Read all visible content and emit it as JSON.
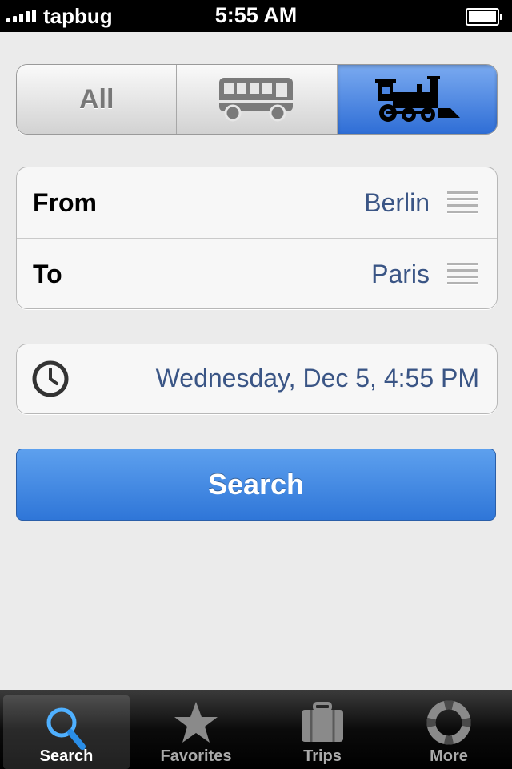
{
  "status_bar": {
    "carrier": "tapbug",
    "time": "5:55 AM"
  },
  "transport_filter": {
    "all_label": "All",
    "options": [
      "all",
      "bus-icon",
      "train-icon"
    ],
    "selected": "train",
    "accent_color": "#2f6ed6"
  },
  "route": {
    "from_label": "From",
    "from_value": "Berlin",
    "to_label": "To",
    "to_value": "Paris"
  },
  "datetime": {
    "value": "Wednesday, Dec 5, 4:55 PM",
    "icon": "clock-icon"
  },
  "search_button": {
    "label": "Search",
    "color": "#3b82dd"
  },
  "tab_bar": {
    "tabs": [
      {
        "label": "Search",
        "icon": "search-icon",
        "active": true
      },
      {
        "label": "Favorites",
        "icon": "star-icon",
        "active": false
      },
      {
        "label": "Trips",
        "icon": "briefcase-icon",
        "active": false
      },
      {
        "label": "More",
        "icon": "lifebuoy-icon",
        "active": false
      }
    ]
  }
}
